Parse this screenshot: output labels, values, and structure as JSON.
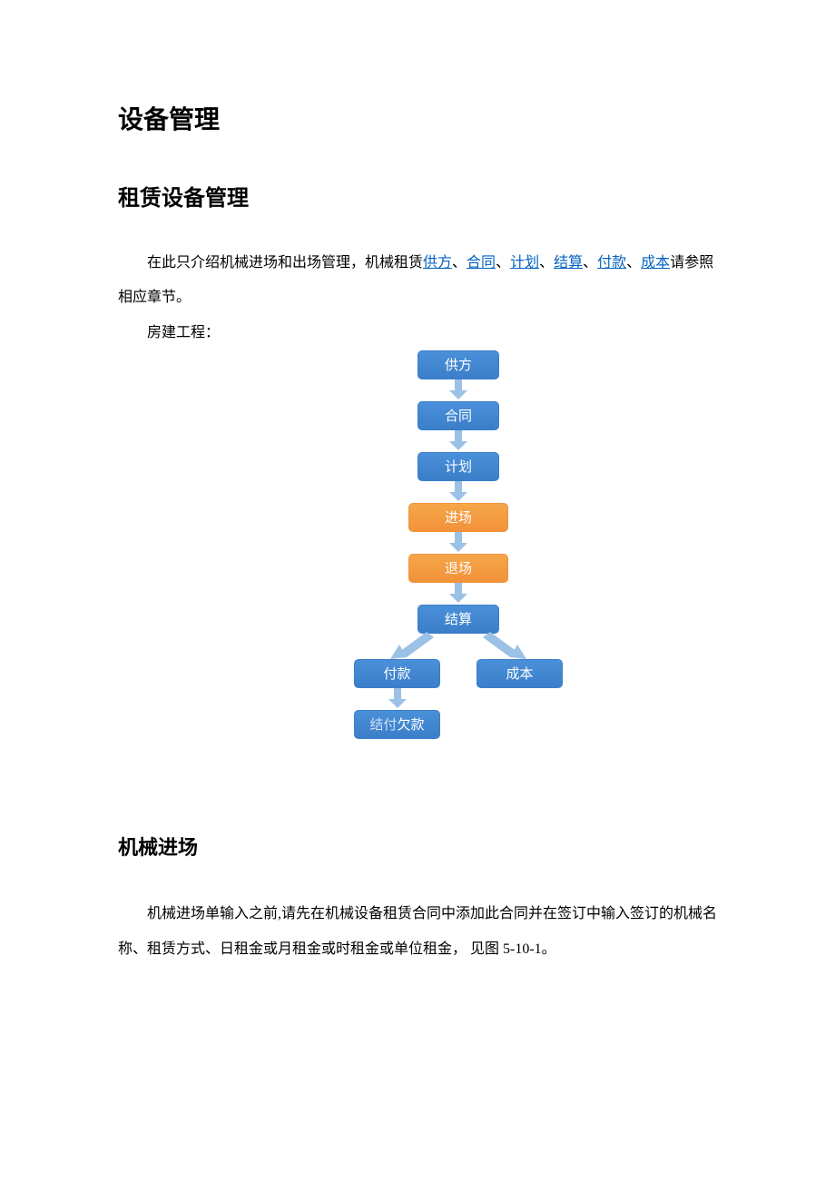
{
  "title": "设备管理",
  "section1_title": "租赁设备管理",
  "intro_prefix": "在此只介绍机械进场和出场管理，机械租赁",
  "links": {
    "l1": "供方",
    "l2": "合同",
    "l3": "计划",
    "l4": "结算",
    "l5": "付款",
    "l6": "成本"
  },
  "sep": "、",
  "intro_suffix": "请参照相应章节。",
  "project_label": "房建工程：",
  "flow": {
    "n1": "供方",
    "n2": "合同",
    "n3": "计划",
    "n4": "进场",
    "n5": "退场",
    "n6": "结算",
    "n7": "付款",
    "n8": "成本",
    "n9a": "结付",
    "n9b": "欠款"
  },
  "section2_title": "机械进场",
  "section2_body": "机械进场单输入之前,请先在机械设备租赁合同中添加此合同并在签订中输入签订的机械名称、租赁方式、日租金或月租金或时租金或单位租金， 见图 5-10-1。"
}
